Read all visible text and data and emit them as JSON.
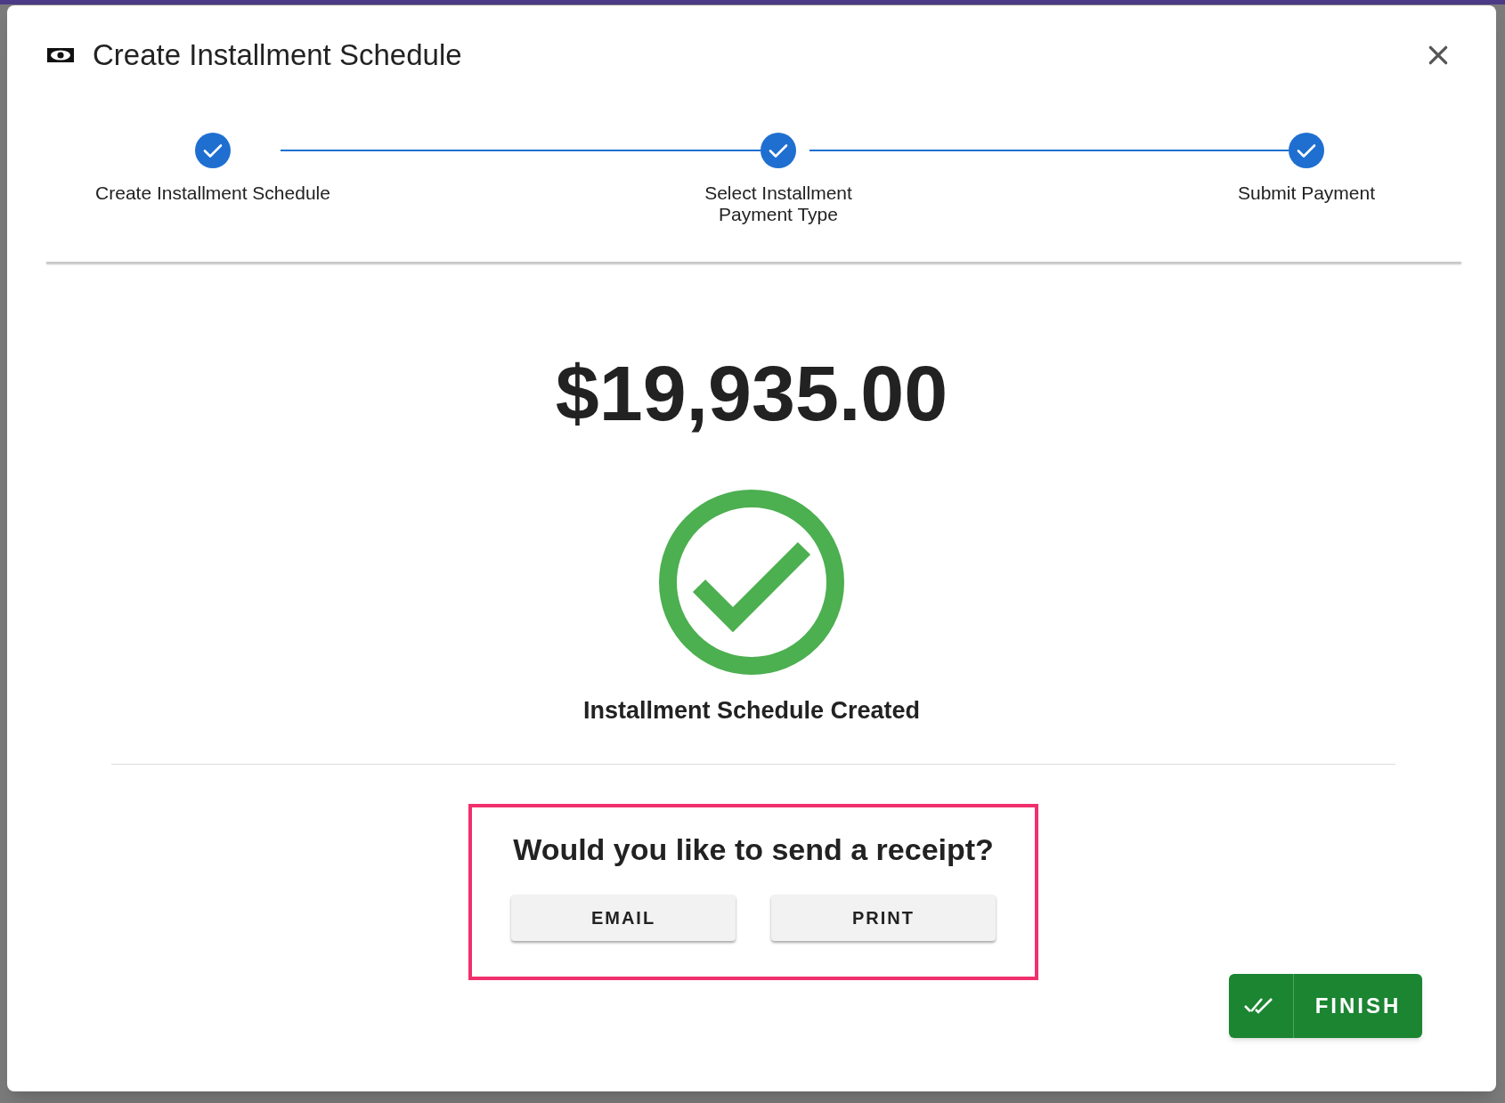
{
  "dialog": {
    "title": "Create Installment Schedule"
  },
  "steps": [
    {
      "label": "Create Installment Schedule",
      "completed": true
    },
    {
      "label": "Select Installment Payment Type",
      "completed": true
    },
    {
      "label": "Submit Payment",
      "completed": true
    }
  ],
  "amount": "$19,935.00",
  "status": "Installment Schedule Created",
  "receipt": {
    "prompt": "Would you like to send a receipt?",
    "buttons": [
      "EMAIL",
      "PRINT"
    ]
  },
  "finish_button": "FINISH"
}
